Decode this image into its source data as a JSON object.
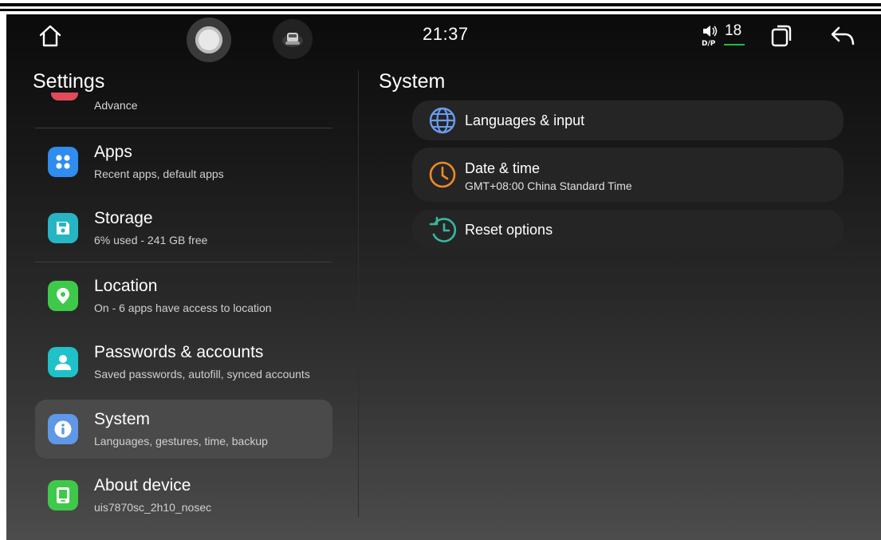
{
  "status_bar": {
    "time": "21:37",
    "volume_label": "D/P",
    "volume": "18",
    "icons": [
      "home-icon",
      "assistant-icon",
      "car-icon",
      "volume-icon",
      "recent-apps-icon",
      "back-icon"
    ]
  },
  "left_panel": {
    "title": "Settings",
    "partial_item": {
      "subtitle": "Advance",
      "color": "#e04a5b"
    },
    "items": [
      {
        "title": "Apps",
        "subtitle": "Recent apps, default apps",
        "icon": "apps-icon",
        "color": "#2f8cf0"
      },
      {
        "title": "Storage",
        "subtitle": "6% used - 241 GB free",
        "icon": "storage-icon",
        "color": "#27b5c4"
      },
      {
        "title": "Location",
        "subtitle": "On - 6 apps have access to location",
        "icon": "location-icon",
        "color": "#3fc94a"
      },
      {
        "title": "Passwords & accounts",
        "subtitle": "Saved passwords, autofill, synced accounts",
        "icon": "account-icon",
        "color": "#1ec2c8"
      },
      {
        "title": "System",
        "subtitle": "Languages, gestures, time, backup",
        "icon": "info-icon",
        "color": "#5f98e6",
        "selected": true
      },
      {
        "title": "About device",
        "subtitle": "uis7870sc_2h10_nosec",
        "icon": "device-icon",
        "color": "#3fc94a"
      }
    ]
  },
  "right_panel": {
    "title": "System",
    "items": [
      {
        "title": "Languages & input",
        "icon": "globe-icon",
        "color": "#6b9cf0"
      },
      {
        "title": "Date & time",
        "subtitle": "GMT+08:00 China Standard Time",
        "icon": "clock-icon",
        "color": "#f08a24"
      },
      {
        "title": "Reset options",
        "icon": "restore-icon",
        "color": "#37b8a0"
      }
    ]
  }
}
